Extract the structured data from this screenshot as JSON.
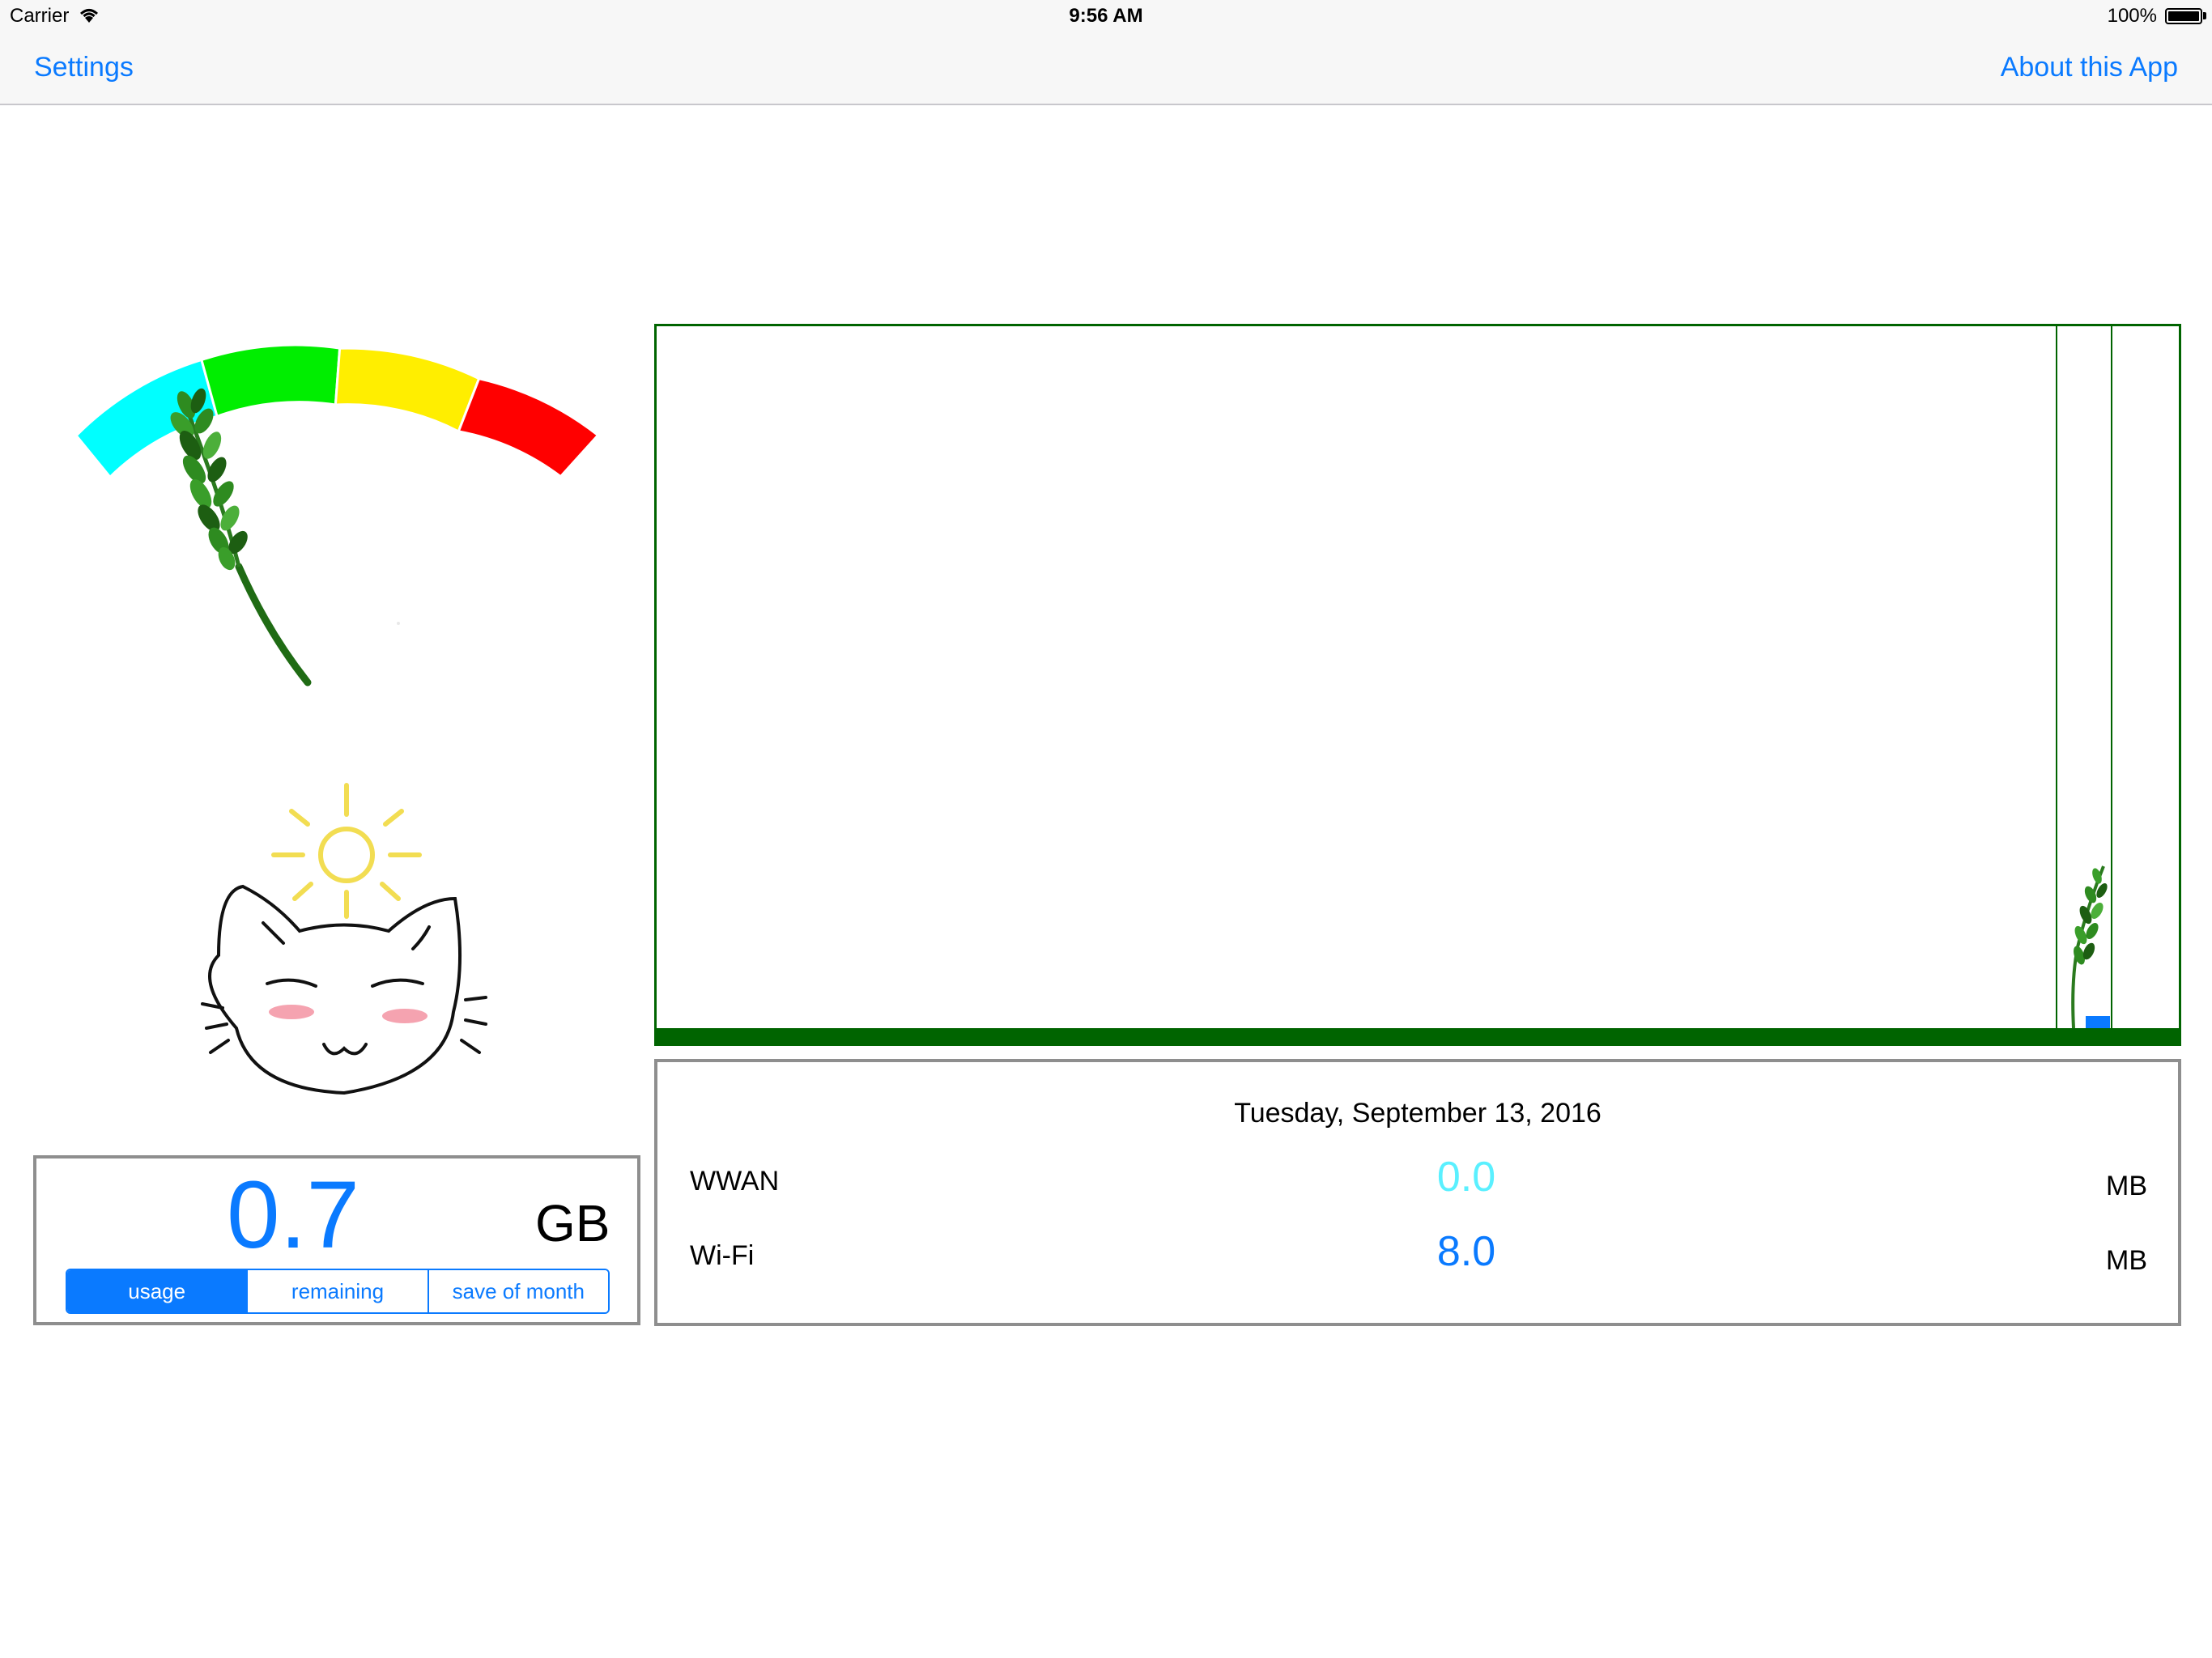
{
  "status_bar": {
    "carrier": "Carrier",
    "time": "9:56 AM",
    "battery": "100%"
  },
  "nav": {
    "left_button": "Settings",
    "right_button": "About this App"
  },
  "gauge": {
    "segment_colors": [
      "#00ffff",
      "#00ee00",
      "#ffee00",
      "#ff0000"
    ]
  },
  "usage": {
    "value": "0.7",
    "unit": "GB",
    "segments": [
      "usage",
      "remaining",
      "save of month"
    ],
    "selected": "usage"
  },
  "details": {
    "date": "Tuesday, September 13, 2016",
    "rows": [
      {
        "label": "WWAN",
        "value": "0.0",
        "unit": "MB",
        "color": "#5af0ff"
      },
      {
        "label": "Wi-Fi",
        "value": "8.0",
        "unit": "MB",
        "color": "#0a7aff"
      }
    ]
  },
  "colors": {
    "accent": "#0a7aff",
    "chart_frame": "#006400",
    "panel_border": "#8e8e8e"
  }
}
